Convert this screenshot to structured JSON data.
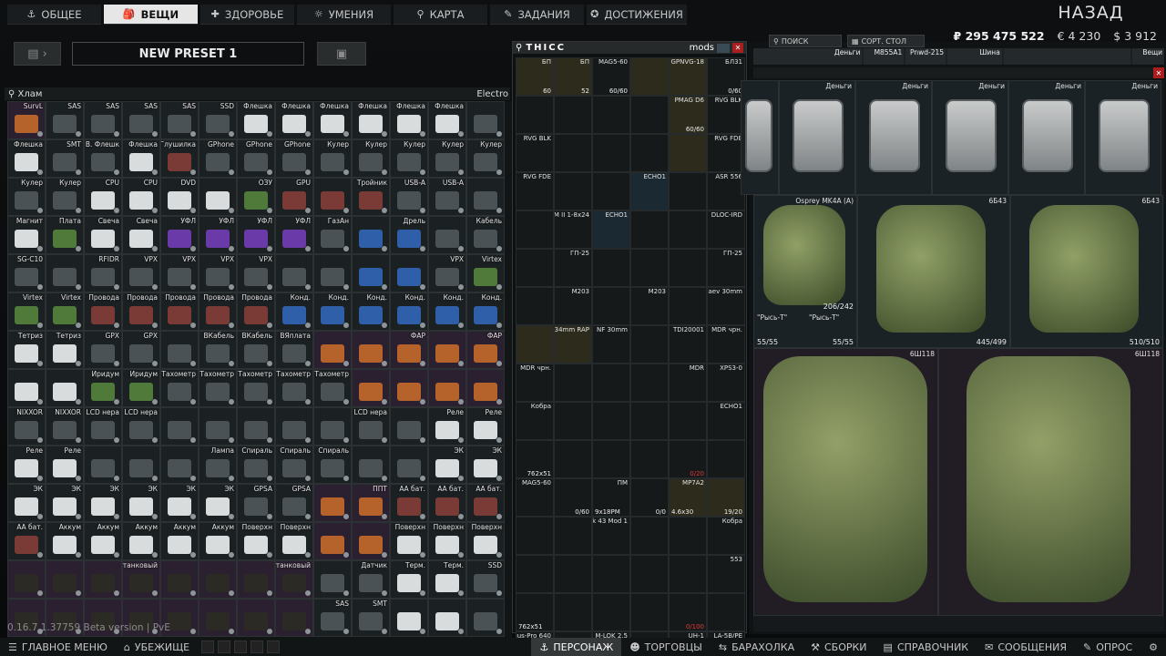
{
  "nav": {
    "tabs": [
      {
        "label": "ОБЩЕЕ",
        "icon": "anchor-icon"
      },
      {
        "label": "ВЕЩИ",
        "icon": "backpack-icon"
      },
      {
        "label": "ЗДОРОВЬЕ",
        "icon": "health-icon"
      },
      {
        "label": "УМЕНИЯ",
        "icon": "skills-icon"
      },
      {
        "label": "КАРТА",
        "icon": "map-pin-icon"
      },
      {
        "label": "ЗАДАНИЯ",
        "icon": "tasks-icon"
      },
      {
        "label": "ДОСТИЖЕНИЯ",
        "icon": "achievements-icon"
      }
    ],
    "back_label": "НАЗАД"
  },
  "currency": {
    "roubles": "₽ 295 475 522",
    "euros": "€ 4 230",
    "dollars": "$ 3 912"
  },
  "preset": {
    "name": "NEW PRESET 1"
  },
  "stash": {
    "filter_label": "Хлам",
    "right_label": "Electro",
    "cells": [
      {
        "l": "SurvL",
        "t": "o"
      },
      {
        "l": "SAS",
        "t": "g"
      },
      {
        "l": "SAS",
        "t": "g"
      },
      {
        "l": "SAS",
        "t": "g"
      },
      {
        "l": "SAS",
        "t": "g"
      },
      {
        "l": "SSD",
        "t": "g"
      },
      {
        "l": "Флешка",
        "t": "w"
      },
      {
        "l": "Флешка",
        "t": "w"
      },
      {
        "l": "Флешка",
        "t": "w"
      },
      {
        "l": "Флешка",
        "t": "w"
      },
      {
        "l": "Флешка",
        "t": "w"
      },
      {
        "l": "Флешка",
        "t": "w"
      },
      {
        "l": "",
        "t": "g"
      },
      {
        "l": "Флешка",
        "t": "w"
      },
      {
        "l": "SMT",
        "t": "g"
      },
      {
        "l": "В. Флешк",
        "t": "g"
      },
      {
        "l": "Флешка",
        "t": "w"
      },
      {
        "l": "Глушилка",
        "t": "r"
      },
      {
        "l": "GPhone",
        "t": "g"
      },
      {
        "l": "GPhone",
        "t": "g"
      },
      {
        "l": "GPhone",
        "t": "g"
      },
      {
        "l": "Кулер",
        "t": "g"
      },
      {
        "l": "Кулер",
        "t": "g"
      },
      {
        "l": "Кулер",
        "t": "g"
      },
      {
        "l": "Кулер",
        "t": "g"
      },
      {
        "l": "Кулер",
        "t": "g"
      },
      {
        "l": "Кулер",
        "t": "g"
      },
      {
        "l": "Кулер",
        "t": "g"
      },
      {
        "l": "CPU",
        "t": "w"
      },
      {
        "l": "CPU",
        "t": "w"
      },
      {
        "l": "DVD",
        "t": "w"
      },
      {
        "l": "",
        "t": "w"
      },
      {
        "l": "ОЗУ",
        "t": "gr"
      },
      {
        "l": "GPU",
        "t": "r"
      },
      {
        "l": "",
        "t": "r"
      },
      {
        "l": "Тройник",
        "t": "r"
      },
      {
        "l": "USB-A",
        "t": "g"
      },
      {
        "l": "USB-A",
        "t": "g"
      },
      {
        "l": "",
        "t": "g"
      },
      {
        "l": "Магнит",
        "t": "w"
      },
      {
        "l": "Плата",
        "t": "gr"
      },
      {
        "l": "Свеча",
        "t": "w"
      },
      {
        "l": "Свеча",
        "t": "w"
      },
      {
        "l": "УФЛ",
        "t": "p"
      },
      {
        "l": "УФЛ",
        "t": "p"
      },
      {
        "l": "УФЛ",
        "t": "p"
      },
      {
        "l": "УФЛ",
        "t": "p"
      },
      {
        "l": "ГазАн",
        "t": "g"
      },
      {
        "l": "",
        "t": "b"
      },
      {
        "l": "Дрель",
        "t": "b"
      },
      {
        "l": "",
        "t": "g"
      },
      {
        "l": "Кабель",
        "t": "g"
      },
      {
        "l": "SG-C10",
        "t": "g"
      },
      {
        "l": "",
        "t": "g"
      },
      {
        "l": "RFIDR",
        "t": "g"
      },
      {
        "l": "VPX",
        "t": "g"
      },
      {
        "l": "VPX",
        "t": "g"
      },
      {
        "l": "VPX",
        "t": "g"
      },
      {
        "l": "VPX",
        "t": "g"
      },
      {
        "l": "",
        "t": "g"
      },
      {
        "l": "",
        "t": "g"
      },
      {
        "l": "",
        "t": "b"
      },
      {
        "l": "",
        "t": "b"
      },
      {
        "l": "VPX",
        "t": "g"
      },
      {
        "l": "Virtex",
        "t": "gr"
      },
      {
        "l": "Virtex",
        "t": "gr"
      },
      {
        "l": "Virtex",
        "t": "gr"
      },
      {
        "l": "Провода",
        "t": "r"
      },
      {
        "l": "Провода",
        "t": "r"
      },
      {
        "l": "Провода",
        "t": "r"
      },
      {
        "l": "Провода",
        "t": "r"
      },
      {
        "l": "Провода",
        "t": "r"
      },
      {
        "l": "Конд.",
        "t": "b"
      },
      {
        "l": "Конд.",
        "t": "b"
      },
      {
        "l": "Конд.",
        "t": "b"
      },
      {
        "l": "Конд.",
        "t": "b"
      },
      {
        "l": "Конд.",
        "t": "b"
      },
      {
        "l": "Конд.",
        "t": "b"
      },
      {
        "l": "Тетриз",
        "t": "w"
      },
      {
        "l": "Тетриз",
        "t": "w"
      },
      {
        "l": "GPX",
        "t": "g"
      },
      {
        "l": "GPX",
        "t": "g"
      },
      {
        "l": "",
        "t": "g"
      },
      {
        "l": "ВКабель",
        "t": "g"
      },
      {
        "l": "ВКабель",
        "t": "g"
      },
      {
        "l": "ВЯплата",
        "t": "g"
      },
      {
        "l": "",
        "t": "o"
      },
      {
        "l": "",
        "t": "o"
      },
      {
        "l": "ФАР",
        "t": "o"
      },
      {
        "l": "",
        "t": "o"
      },
      {
        "l": "ФАР",
        "t": "o"
      },
      {
        "l": "",
        "t": "w"
      },
      {
        "l": "",
        "t": "w"
      },
      {
        "l": "Иридум",
        "t": "gr"
      },
      {
        "l": "Иридум",
        "t": "gr"
      },
      {
        "l": "Тахометр",
        "t": "g"
      },
      {
        "l": "Тахометр",
        "t": "g"
      },
      {
        "l": "Тахометр",
        "t": "g"
      },
      {
        "l": "Тахометр",
        "t": "g"
      },
      {
        "l": "Тахометр",
        "t": "g"
      },
      {
        "l": "",
        "t": "o"
      },
      {
        "l": "",
        "t": "o"
      },
      {
        "l": "",
        "t": "o"
      },
      {
        "l": "",
        "t": "o"
      },
      {
        "l": "NIXXOR",
        "t": "g"
      },
      {
        "l": "NIXXOR",
        "t": "g"
      },
      {
        "l": "LCD нера",
        "t": "g"
      },
      {
        "l": "LCD нера",
        "t": "g"
      },
      {
        "l": "",
        "t": "g"
      },
      {
        "l": "",
        "t": "g"
      },
      {
        "l": "",
        "t": "g"
      },
      {
        "l": "",
        "t": "g"
      },
      {
        "l": "",
        "t": "g"
      },
      {
        "l": "LCD нера",
        "t": "g"
      },
      {
        "l": "",
        "t": "g"
      },
      {
        "l": "Реле",
        "t": "w"
      },
      {
        "l": "Реле",
        "t": "w"
      },
      {
        "l": "Реле",
        "t": "w"
      },
      {
        "l": "Реле",
        "t": "w"
      },
      {
        "l": "",
        "t": "g"
      },
      {
        "l": "",
        "t": "g"
      },
      {
        "l": "",
        "t": "g"
      },
      {
        "l": "Лампа",
        "t": "g"
      },
      {
        "l": "Спираль",
        "t": "g"
      },
      {
        "l": "Спираль",
        "t": "g"
      },
      {
        "l": "Спираль",
        "t": "g"
      },
      {
        "l": "",
        "t": "g"
      },
      {
        "l": "",
        "t": "g"
      },
      {
        "l": "ЭК",
        "t": "w"
      },
      {
        "l": "ЭК",
        "t": "w"
      },
      {
        "l": "ЭК",
        "t": "w"
      },
      {
        "l": "ЭК",
        "t": "w"
      },
      {
        "l": "ЭК",
        "t": "w"
      },
      {
        "l": "ЭК",
        "t": "w"
      },
      {
        "l": "ЭК",
        "t": "w"
      },
      {
        "l": "ЭК",
        "t": "w"
      },
      {
        "l": "GPSA",
        "t": "g"
      },
      {
        "l": "GPSA",
        "t": "g"
      },
      {
        "l": "",
        "t": "o"
      },
      {
        "l": "ППТ",
        "t": "o"
      },
      {
        "l": "АА бат.",
        "t": "r"
      },
      {
        "l": "АА бат.",
        "t": "r"
      },
      {
        "l": "АА бат.",
        "t": "r"
      },
      {
        "l": "АА бат.",
        "t": "r"
      },
      {
        "l": "Аккум",
        "t": "w"
      },
      {
        "l": "Аккум",
        "t": "w"
      },
      {
        "l": "Аккум",
        "t": "w"
      },
      {
        "l": "Аккум",
        "t": "w"
      },
      {
        "l": "Аккум",
        "t": "w"
      },
      {
        "l": "Поверхн",
        "t": "w"
      },
      {
        "l": "Поверхн",
        "t": "w"
      },
      {
        "l": "",
        "t": "o"
      },
      {
        "l": "",
        "t": "o"
      },
      {
        "l": "Поверхн",
        "t": "w"
      },
      {
        "l": "Поверхн",
        "t": "w"
      },
      {
        "l": "Поверхн",
        "t": "w"
      },
      {
        "l": "",
        "t": "k"
      },
      {
        "l": "",
        "t": "k"
      },
      {
        "l": "",
        "t": "k"
      },
      {
        "l": "АКБ танковый",
        "t": "k"
      },
      {
        "l": "",
        "t": "k"
      },
      {
        "l": "",
        "t": "k"
      },
      {
        "l": "",
        "t": "k"
      },
      {
        "l": "АКБ танковый",
        "t": "k"
      },
      {
        "l": "",
        "t": "g"
      },
      {
        "l": "Датчик",
        "t": "g"
      },
      {
        "l": "Терм.",
        "t": "w"
      },
      {
        "l": "Терм.",
        "t": "w"
      },
      {
        "l": "SSD",
        "t": "g"
      },
      {
        "l": "",
        "t": "k"
      },
      {
        "l": "",
        "t": "k"
      },
      {
        "l": "",
        "t": "k"
      },
      {
        "l": "",
        "t": "k"
      },
      {
        "l": "",
        "t": "k"
      },
      {
        "l": "",
        "t": "k"
      },
      {
        "l": "",
        "t": "k"
      },
      {
        "l": "",
        "t": "k"
      },
      {
        "l": "SAS",
        "t": "g"
      },
      {
        "l": "SMT",
        "t": "g"
      },
      {
        "l": "",
        "t": "w"
      },
      {
        "l": "",
        "t": "w"
      },
      {
        "l": "",
        "t": "g"
      }
    ]
  },
  "version": "0.16.7.1.37759 Beta version | PvE",
  "mods": {
    "title": "THICC",
    "tab": "mods",
    "cells": [
      {
        "l": "БП",
        "c": "60",
        "k": "gold"
      },
      {
        "l": "БП",
        "c": "52",
        "k": "gold"
      },
      {
        "l": "MAG5-60",
        "c": "60/60",
        "k": ""
      },
      {
        "l": "",
        "c": "",
        "k": "gold"
      },
      {
        "l": "GPNVG-18",
        "c": "",
        "k": "gold"
      },
      {
        "l": "БЛ31",
        "c": "0/60",
        "k": ""
      },
      {
        "l": "",
        "c": "",
        "k": ""
      },
      {
        "l": "",
        "c": "",
        "k": ""
      },
      {
        "l": "",
        "c": "",
        "k": ""
      },
      {
        "l": "",
        "c": "",
        "k": ""
      },
      {
        "l": "PMAG D6",
        "c": "60/60",
        "k": "gold"
      },
      {
        "l": "RVG BLK",
        "c": "",
        "k": ""
      },
      {
        "l": "RVG BLK",
        "c": "",
        "k": ""
      },
      {
        "l": "",
        "c": "",
        "k": ""
      },
      {
        "l": "",
        "c": "",
        "k": ""
      },
      {
        "l": "",
        "c": "",
        "k": ""
      },
      {
        "l": "",
        "c": "",
        "k": "gold"
      },
      {
        "l": "RVG FDE",
        "c": "",
        "k": ""
      },
      {
        "l": "RVG FDE",
        "c": "",
        "k": ""
      },
      {
        "l": "",
        "c": "",
        "k": ""
      },
      {
        "l": "",
        "c": "",
        "k": ""
      },
      {
        "l": "ECHO1",
        "c": "",
        "k": "blue"
      },
      {
        "l": "",
        "c": "",
        "k": ""
      },
      {
        "l": "ASR 556",
        "c": "",
        "k": ""
      },
      {
        "l": "",
        "c": "",
        "k": ""
      },
      {
        "l": "PM II 1-8x24",
        "c": "",
        "k": ""
      },
      {
        "l": "ECHO1",
        "c": "",
        "k": "blue"
      },
      {
        "l": "",
        "c": "",
        "k": ""
      },
      {
        "l": "",
        "c": "",
        "k": ""
      },
      {
        "l": "DLOC-IRD",
        "c": "",
        "k": ""
      },
      {
        "l": "",
        "c": "",
        "k": ""
      },
      {
        "l": "ГП-25",
        "c": "",
        "k": ""
      },
      {
        "l": "",
        "c": "",
        "k": ""
      },
      {
        "l": "",
        "c": "",
        "k": ""
      },
      {
        "l": "",
        "c": "",
        "k": ""
      },
      {
        "l": "ГП-25",
        "c": "",
        "k": ""
      },
      {
        "l": "",
        "c": "",
        "k": ""
      },
      {
        "l": "M203",
        "c": "",
        "k": ""
      },
      {
        "l": "",
        "c": "",
        "k": ""
      },
      {
        "l": "M203",
        "c": "",
        "k": ""
      },
      {
        "l": "",
        "c": "",
        "k": ""
      },
      {
        "l": "Lobaev 30mm",
        "c": "",
        "k": ""
      },
      {
        "l": "",
        "c": "",
        "k": "gold"
      },
      {
        "l": "NF 34mm RAP",
        "c": "",
        "k": "gold"
      },
      {
        "l": "NF 30mm",
        "c": "",
        "k": ""
      },
      {
        "l": "",
        "c": "",
        "k": ""
      },
      {
        "l": "TDI20001",
        "c": "",
        "k": ""
      },
      {
        "l": "MDR чрн.",
        "c": "",
        "k": ""
      },
      {
        "l": "MDR чрн.",
        "c": "",
        "k": ""
      },
      {
        "l": "",
        "c": "",
        "k": ""
      },
      {
        "l": "",
        "c": "",
        "k": ""
      },
      {
        "l": "",
        "c": "",
        "k": ""
      },
      {
        "l": "MDR",
        "c": "",
        "k": ""
      },
      {
        "l": "XPS3-0",
        "c": "",
        "k": ""
      },
      {
        "l": "Кобра",
        "c": "",
        "k": ""
      },
      {
        "l": "",
        "c": "",
        "k": ""
      },
      {
        "l": "",
        "c": "",
        "k": ""
      },
      {
        "l": "",
        "c": "",
        "k": ""
      },
      {
        "l": "",
        "c": "",
        "k": ""
      },
      {
        "l": "ECHO1",
        "c": "",
        "k": ""
      },
      {
        "l": "",
        "c": "762x51",
        "k": ""
      },
      {
        "l": "",
        "c": "",
        "k": ""
      },
      {
        "l": "",
        "c": "",
        "k": ""
      },
      {
        "l": "",
        "c": "",
        "k": ""
      },
      {
        "l": "",
        "c": "0/20",
        "k": "",
        "r": true
      },
      {
        "l": "",
        "c": "",
        "k": ""
      },
      {
        "l": "MAG5-60",
        "c": "",
        "k": ""
      },
      {
        "l": "",
        "c": "0/60",
        "k": ""
      },
      {
        "l": "ПМ",
        "c": "9x18PM",
        "k": "",
        "lf": true
      },
      {
        "l": "",
        "c": "0/0",
        "k": ""
      },
      {
        "l": "MP7A2",
        "c": "4.6x30",
        "k": "gold",
        "lf": true
      },
      {
        "l": "",
        "c": "19/20",
        "k": "gold"
      },
      {
        "l": "",
        "c": "",
        "k": ""
      },
      {
        "l": "",
        "c": "",
        "k": ""
      },
      {
        "l": "Mk 43 Mod 1",
        "c": "",
        "k": ""
      },
      {
        "l": "",
        "c": "",
        "k": ""
      },
      {
        "l": "",
        "c": "",
        "k": ""
      },
      {
        "l": "Кобра",
        "c": "",
        "k": ""
      },
      {
        "l": "",
        "c": "",
        "k": ""
      },
      {
        "l": "",
        "c": "",
        "k": ""
      },
      {
        "l": "",
        "c": "",
        "k": ""
      },
      {
        "l": "",
        "c": "",
        "k": ""
      },
      {
        "l": "",
        "c": "",
        "k": ""
      },
      {
        "l": "553",
        "c": "",
        "k": ""
      },
      {
        "l": "",
        "c": "762x51",
        "k": "",
        "lf": true
      },
      {
        "l": "",
        "c": "",
        "k": ""
      },
      {
        "l": "",
        "c": "",
        "k": ""
      },
      {
        "l": "",
        "c": "",
        "k": ""
      },
      {
        "l": "",
        "c": "0/100",
        "k": "",
        "r": true
      },
      {
        "l": "",
        "c": "",
        "k": ""
      },
      {
        "l": "Zeus-Pro 640",
        "c": "",
        "k": ""
      },
      {
        "l": "",
        "c": "",
        "k": ""
      },
      {
        "l": "M-LOK 2.5",
        "c": "",
        "k": ""
      },
      {
        "l": "",
        "c": "",
        "k": ""
      },
      {
        "l": "UH-1",
        "c": "",
        "k": ""
      },
      {
        "l": "LA-5B/PE",
        "c": "",
        "k": ""
      }
    ]
  },
  "right_panel": {
    "search_label": "ПОИСК",
    "sort_label": "СОРТ. СТОЛ",
    "strip": [
      "Деньги",
      "M855A1",
      "Pnwd-215",
      "Шина",
      "",
      "Вещи"
    ],
    "cases": [
      "Деньги",
      "Деньги",
      "Деньги",
      "Деньги",
      "Деньги",
      "Деньги"
    ],
    "armors": [
      {
        "label": "Osprey MK4A (A)",
        "sub": "\"Рысь-Т\"",
        "count": "206/242",
        "count2": "55/55",
        "helmet": "\"Рысь-Т\"",
        "helmet_count": "55/55"
      },
      {
        "label": "6Б43",
        "count": "445/499"
      },
      {
        "label": "6Б43",
        "count": "510/510"
      }
    ],
    "packs": [
      {
        "label": "6Ш118"
      },
      {
        "label": "6Ш118"
      }
    ]
  },
  "bottom": {
    "left": [
      {
        "label": "ГЛАВНОЕ МЕНЮ",
        "icon": "menu-icon"
      },
      {
        "label": "УБЕЖИЩЕ",
        "icon": "hideout-icon"
      }
    ],
    "right": [
      {
        "label": "ПЕРСОНАЖ",
        "icon": "anchor-icon",
        "active": true
      },
      {
        "label": "ТОРГОВЦЫ",
        "icon": "traders-icon"
      },
      {
        "label": "БАРАХОЛКА",
        "icon": "flea-icon"
      },
      {
        "label": "СБОРКИ",
        "icon": "builds-icon"
      },
      {
        "label": "СПРАВОЧНИК",
        "icon": "handbook-icon"
      },
      {
        "label": "СООБЩЕНИЯ",
        "icon": "messages-icon"
      },
      {
        "label": "ОПРОС",
        "icon": "survey-icon"
      }
    ]
  },
  "colors": {
    "accent": "#e6e6e6",
    "close": "#a91e1e",
    "fir_found": "#2a2e24",
    "bigslot": "#2b2030"
  }
}
